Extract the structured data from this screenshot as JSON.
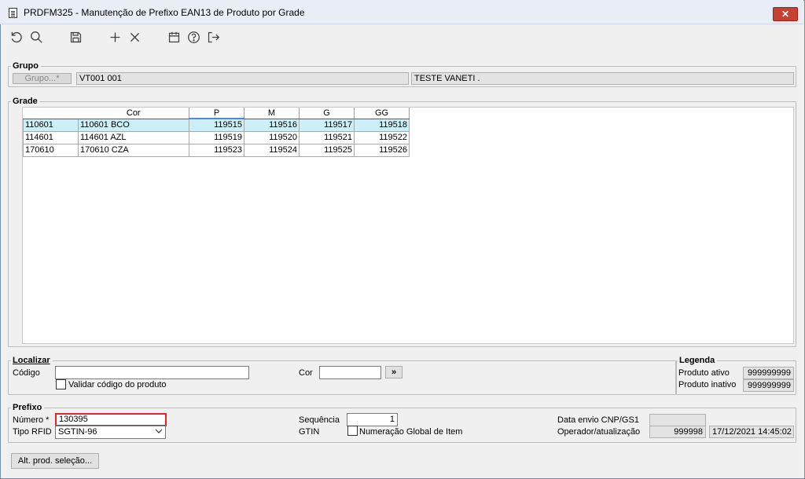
{
  "window": {
    "title": "PRDFM325 - Manutenção de Prefixo EAN13 de Produto por Grade",
    "close_label": "✕"
  },
  "toolbar": [
    "refresh-icon",
    "search-icon",
    "save-icon",
    "add-icon",
    "delete-icon",
    "calendar-icon",
    "help-icon",
    "exit-icon"
  ],
  "grupo": {
    "title": "Grupo",
    "button_label": "Grupo...*",
    "code": "VT001 001",
    "name": "TESTE VANETI ."
  },
  "grade": {
    "title": "Grade",
    "columns": [
      "Cor",
      "P",
      "M",
      "G",
      "GG"
    ],
    "rows": [
      {
        "code": "110601",
        "cor": "110601 BCO",
        "p": "119515",
        "m": "119516",
        "g": "119517",
        "gg": "119518"
      },
      {
        "code": "114601",
        "cor": "114601 AZL",
        "p": "119519",
        "m": "119520",
        "g": "119521",
        "gg": "119522"
      },
      {
        "code": "170610",
        "cor": "170610 CZA",
        "p": "119523",
        "m": "119524",
        "g": "119525",
        "gg": "119526"
      }
    ]
  },
  "localizar": {
    "title": "Localizar",
    "codigo_label": "Código",
    "codigo_value": "",
    "validar_label": "Validar código do produto",
    "cor_label": "Cor",
    "cor_value": "",
    "go_label": "»"
  },
  "legenda": {
    "title": "Legenda",
    "ativo_label": "Produto ativo",
    "ativo_value": "999999999",
    "inativo_label": "Produto inativo",
    "inativo_value": "999999999"
  },
  "prefixo": {
    "title": "Prefixo",
    "numero_label": "Número *",
    "numero_value": "130395",
    "tipo_label": "Tipo RFID",
    "tipo_value": "SGTIN-96",
    "sequencia_label": "Sequência",
    "sequencia_value": "1",
    "gtin_label": "GTIN",
    "gtin_check_label": "Numeração Global de Item",
    "data_envio_label": "Data envio CNP/GS1",
    "data_envio_value": "",
    "operador_label": "Operador/atualização",
    "operador_value": "999998",
    "atualizacao_value": "17/12/2021 14:45:02"
  },
  "footer": {
    "alt_button_label": "Alt. prod. seleção..."
  },
  "colors": {
    "selected_row": "#cdf0f8",
    "error_border": "#e0262b",
    "close_button": "#c84031"
  }
}
